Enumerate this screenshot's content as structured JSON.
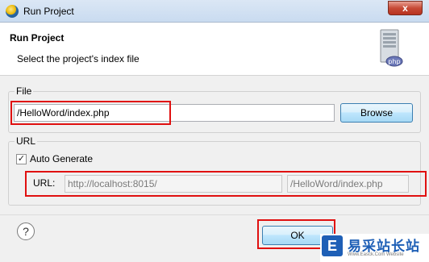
{
  "window": {
    "title": "Run Project",
    "close_glyph": "x",
    "app_icon": "eclipse-icon"
  },
  "header": {
    "title": "Run Project",
    "description": "Select the project's index file",
    "icon": "php-server-icon",
    "icon_badge": "php"
  },
  "file_group": {
    "label": "File",
    "path_value": "/HelloWord/index.php",
    "browse_label": "Browse"
  },
  "url_group": {
    "label": "URL",
    "auto_generate_label": "Auto Generate",
    "auto_generate_checked": true,
    "check_glyph": "✓",
    "url_label": "URL:",
    "host_value": "http://localhost:8015/",
    "path_value": "/HelloWord/index.php"
  },
  "footer": {
    "help_glyph": "?",
    "ok_label": "OK"
  },
  "watermark": {
    "logo": "E",
    "text": "易采站长站",
    "sub": "Www.Easck.Com Website"
  },
  "colors": {
    "highlight_box": "#e01010",
    "button_focus": "#3c7fb1"
  }
}
